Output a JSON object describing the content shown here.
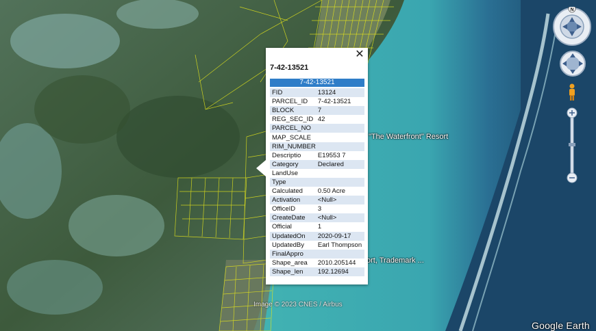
{
  "map": {
    "labels": {
      "resort": "\"The Waterfront\" Resort",
      "trademark": "ort, Trademark ..."
    },
    "attribution": "Image © 2023 CNES / Airbus",
    "brand": "Google Earth",
    "compass_letter": "N"
  },
  "popup": {
    "title": "7-42-13521",
    "header": "7-42-13521",
    "close_glyph": "✕",
    "rows": [
      {
        "key": "FID",
        "value": "13124"
      },
      {
        "key": "PARCEL_ID",
        "value": "7-42-13521"
      },
      {
        "key": "BLOCK",
        "value": "7"
      },
      {
        "key": "REG_SEC_ID",
        "value": "42"
      },
      {
        "key": "PARCEL_NO",
        "value": ""
      },
      {
        "key": "MAP_SCALE",
        "value": ""
      },
      {
        "key": "RIM_NUMBER",
        "value": ""
      },
      {
        "key": "Descriptio",
        "value": "E19553 7"
      },
      {
        "key": "Category",
        "value": "Declared"
      },
      {
        "key": "LandUse",
        "value": ""
      },
      {
        "key": "Type",
        "value": ""
      },
      {
        "key": "Calculated",
        "value": "0.50 Acre"
      },
      {
        "key": "Activation",
        "value": "<Null>"
      },
      {
        "key": "OfficeID",
        "value": "3"
      },
      {
        "key": "CreateDate",
        "value": "<Null>"
      },
      {
        "key": "Official",
        "value": "1"
      },
      {
        "key": "UpdatedOn",
        "value": "2020-09-17"
      },
      {
        "key": "UpdatedBy",
        "value": "Earl Thompson"
      },
      {
        "key": "FinalAppro",
        "value": ""
      },
      {
        "key": "Shape_area",
        "value": "2010.205144"
      },
      {
        "key": "Shape_len",
        "value": "192.12694"
      }
    ]
  },
  "colors": {
    "popup_header": "#2f7dc8",
    "parcel_lines": "#e6e61a",
    "sea_shallow": "#3fb0b4",
    "sea_deep": "#173c5e",
    "land": "#3f5a3a"
  },
  "icons": [
    "close-icon",
    "compass-icon",
    "look-icon",
    "pegman-icon",
    "zoom-in-icon",
    "zoom-out-icon"
  ]
}
